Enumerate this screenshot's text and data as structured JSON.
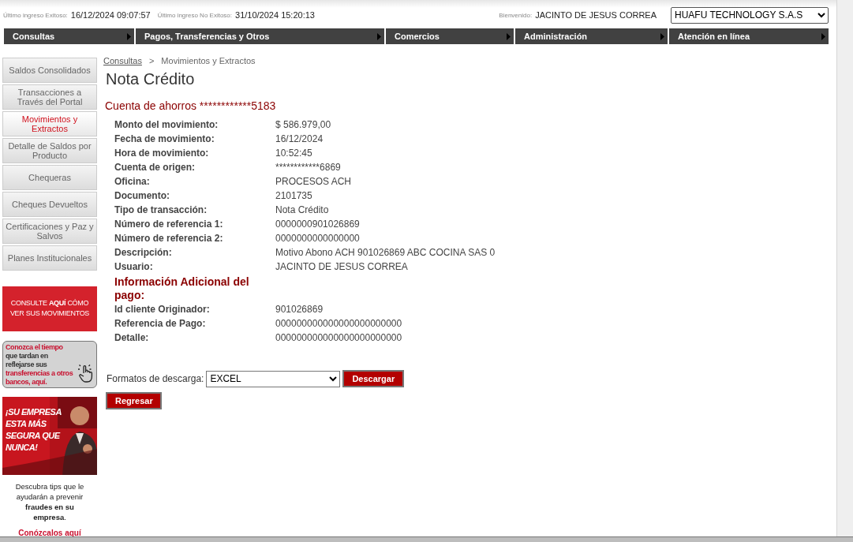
{
  "session": {
    "last_ok_label": "Último ingreso Exitoso:",
    "last_ok_value": "16/12/2024 09:07:57",
    "last_fail_label": "Último ingreso No Exitoso:",
    "last_fail_value": "31/10/2024 15:20:13",
    "welcome_label": "Bienvenido:",
    "user_name": "JACINTO DE JESUS CORREA",
    "company": "HUAFU TECHNOLOGY S.A.S"
  },
  "menu": [
    "Consultas",
    "Pagos, Transferencias y Otros",
    "Comercios",
    "Administración",
    "Atención en línea"
  ],
  "sidebar": {
    "items": [
      {
        "label": "Saldos Consolidados",
        "selected": false
      },
      {
        "label": "Transacciones a Través del Portal",
        "selected": false
      },
      {
        "label": "Movimientos y Extractos",
        "selected": true
      },
      {
        "label": "Detalle de Saldos por Producto",
        "selected": false
      },
      {
        "label": "Chequeras",
        "selected": false
      },
      {
        "label": "Cheques Devueltos",
        "selected": false
      },
      {
        "label": "Certificaciones y Paz y Salvos",
        "selected": false
      },
      {
        "label": "Planes Institucionales",
        "selected": false
      }
    ],
    "banner_movements": "CONSULTE **AQUÍ** CÓMO VER SUS MOVIMIENTOS",
    "banner_transfers": [
      {
        "text": "Conozca el tiempo",
        "highlight": true
      },
      {
        "text": " que tardan en reflejarse sus ",
        "highlight": false
      },
      {
        "text": "transferencias a otros bancos, aquí.",
        "highlight": true
      }
    ],
    "banner_security": {
      "headline": "¡SU EMPRESA ESTA MÁS SEGURA QUE NUNCA!",
      "caption": "Descubra tips que le ayudarán a prevenir **fraudes en su empresa**.",
      "link": "Conózcalos aquí"
    }
  },
  "breadcrumb": {
    "link": "Consultas",
    "separator": ">",
    "current": "Movimientos y Extractos"
  },
  "title": "Nota Crédito",
  "account": "Cuenta de ahorros ************5183",
  "details": [
    {
      "label": "Monto del movimiento:",
      "value": "$ 586.979,00"
    },
    {
      "label": "Fecha de movimiento:",
      "value": "16/12/2024"
    },
    {
      "label": "Hora de movimiento:",
      "value": "10:52:45"
    },
    {
      "label": "Cuenta de origen:",
      "value": "************6869"
    },
    {
      "label": "Oficina:",
      "value": "PROCESOS ACH"
    },
    {
      "label": "Documento:",
      "value": "2101735"
    },
    {
      "label": "Tipo de transacción:",
      "value": "Nota Crédito"
    },
    {
      "label": "Número de referencia 1:",
      "value": "0000000901026869"
    },
    {
      "label": "Número de referencia 2:",
      "value": "0000000000000000"
    },
    {
      "label": "Descripción:",
      "value": "Motivo Abono ACH 901026869 ABC COCINA SAS 0"
    },
    {
      "label": "Usuario:",
      "value": "JACINTO DE JESUS CORREA"
    }
  ],
  "additional_title": "Información Adicional del pago:",
  "additional": [
    {
      "label": "Id cliente Originador:",
      "value": "901026869"
    },
    {
      "label": "Referencia de Pago:",
      "value": "000000000000000000000000"
    },
    {
      "label": "Detalle:",
      "value": "000000000000000000000000"
    }
  ],
  "download": {
    "label": "Formatos de descarga:",
    "format": "EXCEL",
    "button": "Descargar"
  },
  "back_button": "Regresar"
}
